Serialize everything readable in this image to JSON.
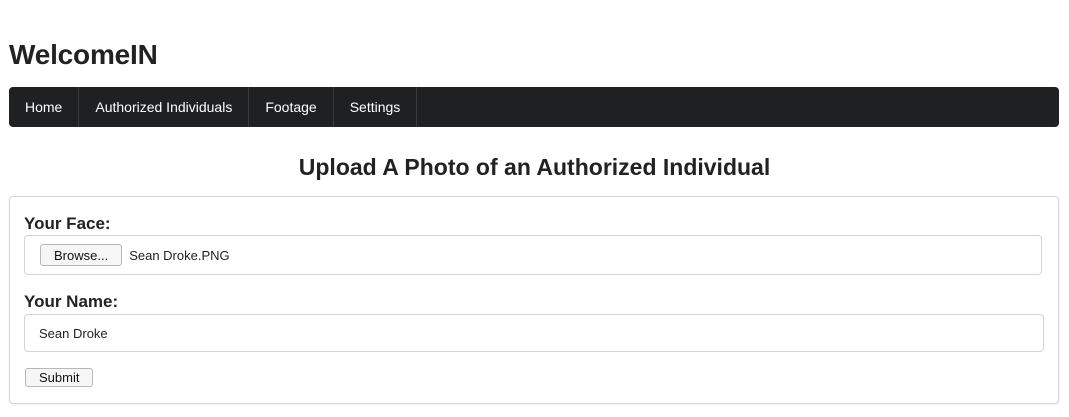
{
  "app": {
    "title": "WelcomeIN"
  },
  "nav": {
    "items": [
      {
        "label": "Home"
      },
      {
        "label": "Authorized Individuals"
      },
      {
        "label": "Footage"
      },
      {
        "label": "Settings"
      }
    ]
  },
  "page": {
    "heading": "Upload A Photo of an Authorized Individual"
  },
  "form": {
    "face_label": "Your Face:",
    "browse_label": "Browse...",
    "file_name": "Sean Droke.PNG",
    "name_label": "Your Name:",
    "name_value": "Sean Droke",
    "submit_label": "Submit"
  },
  "colors": {
    "navbar_bg": "#1f2022",
    "navbar_text": "#ffffff",
    "text": "#222222"
  }
}
